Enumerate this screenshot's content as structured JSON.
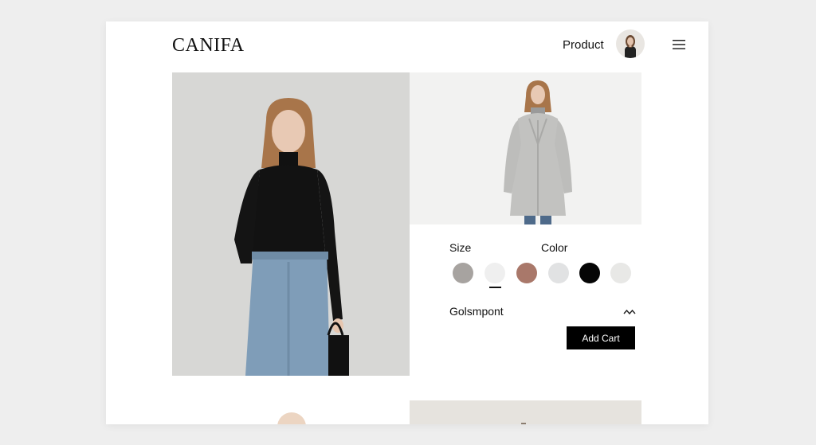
{
  "header": {
    "logo": "CANIFA",
    "nav_label": "Product"
  },
  "options": {
    "size_label": "Size",
    "color_label": "Color",
    "swatches": [
      {
        "name": "taupe-grey",
        "color": "#a7a3a0"
      },
      {
        "name": "white",
        "color": "#efefef",
        "selected": true
      },
      {
        "name": "brown",
        "color": "#a9786a"
      },
      {
        "name": "light-grey",
        "color": "#e1e2e3"
      },
      {
        "name": "black",
        "color": "#050505"
      },
      {
        "name": "off-white",
        "color": "#e8e8e6"
      }
    ]
  },
  "dropdown": {
    "label": "Golsmpont"
  },
  "actions": {
    "add_cart_label": "Add Cart"
  },
  "icons": {
    "menu": "hamburger-menu-icon",
    "chevron": "wavy-chevron-icon"
  },
  "colors": {
    "page_bg": "#eeeeee",
    "card_bg": "#ffffff",
    "button_bg": "#000000",
    "button_text": "#ffffff"
  }
}
